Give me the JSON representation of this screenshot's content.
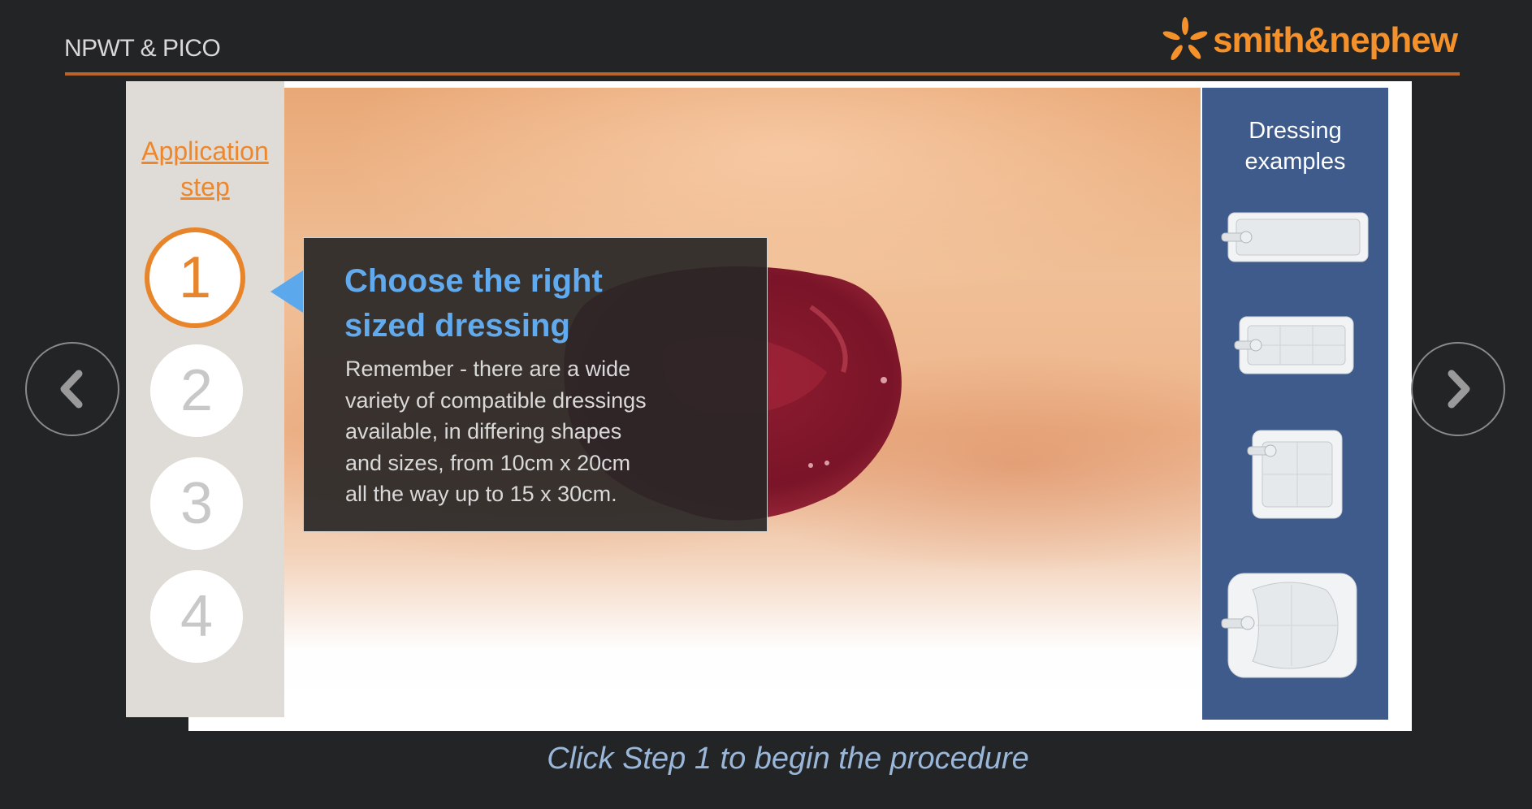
{
  "header": {
    "title": "NPWT & PICO",
    "brand": "smith&nephew"
  },
  "steps_panel": {
    "heading_line1": "Application",
    "heading_line2": "step",
    "steps": [
      "1",
      "2",
      "3",
      "4"
    ],
    "active_step": "1"
  },
  "callout": {
    "title_line1": "Choose the right",
    "title_line2": "sized dressing",
    "body_lines": [
      "Remember - there are a wide",
      "variety of compatible dressings",
      "available, in differing shapes",
      "and sizes, from 10cm x 20cm",
      "all the way up to 15 x 30cm."
    ]
  },
  "dressings_panel": {
    "heading_line1": "Dressing",
    "heading_line2": "examples",
    "items": [
      "rectangular-long-dressing-icon",
      "rectangular-grid-dressing-icon",
      "square-dressing-icon",
      "multisite-dressing-icon"
    ]
  },
  "navigation": {
    "prev_icon": "chevron-left-icon",
    "next_icon": "chevron-right-icon"
  },
  "caption": "Click Step 1 to begin the procedure",
  "colors": {
    "background": "#232426",
    "accent_orange": "#f0862a",
    "title_blue": "#62aaee",
    "panel_blue": "#3e5b8b",
    "caption_blue": "#9ab7d9"
  }
}
